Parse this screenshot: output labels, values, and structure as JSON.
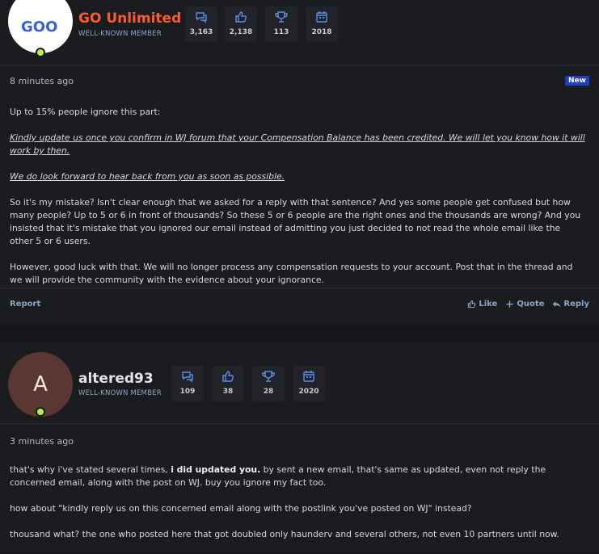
{
  "posts": [
    {
      "user": {
        "name": "GO Unlimited",
        "role": "WELL-KNOWN MEMBER",
        "avatar_text": "GOO",
        "online": true
      },
      "stats": [
        {
          "icon": "messages-icon",
          "value": "3,163"
        },
        {
          "icon": "thumbs-up-icon",
          "value": "2,138"
        },
        {
          "icon": "trophy-icon",
          "value": "113"
        },
        {
          "icon": "calendar-icon",
          "value": "2018"
        }
      ],
      "time": "8 minutes ago",
      "badge": "New",
      "paragraphs": [
        "Up to 15% people ignore this part:",
        "Kindly update us once you confirm in WJ forum that your Compensation Balance has been credited. We will let you know how it will work by then.",
        "We do look forward to hear back from you as soon as possible.",
        "So it's my mistake? Isn't clear enough that we asked for a reply with that sentence? And yes some people get confused but how many people? Up to 5 or 6 in front of thousands? So these 5 or 6 people are the right ones and the thousands are wrong? And you insisted that it's mistake that you ignored our email instead of admitting you just decided to not read the whole email like the other 5 or 6 users.",
        "However, good luck with that. We will no longer process any compensation requests to your account. Post that in the thread and we will provide the community with the evidence about your ignorance."
      ],
      "footer": {
        "report": "Report",
        "like": "Like",
        "quote": "Quote",
        "reply": "Reply"
      }
    },
    {
      "user": {
        "name": "altered93",
        "role": "WELL-KNOWN MEMBER",
        "avatar_text": "A",
        "online": true
      },
      "stats": [
        {
          "icon": "messages-icon",
          "value": "109"
        },
        {
          "icon": "thumbs-up-icon",
          "value": "38"
        },
        {
          "icon": "trophy-icon",
          "value": "28"
        },
        {
          "icon": "calendar-icon",
          "value": "2020"
        }
      ],
      "time": "3 minutes ago",
      "paragraphs": {
        "p1_before": "that's why i've stated several times, ",
        "p1_bold": "i did updated you.",
        "p1_after": " by sent a new email, that's same as updated, even not reply the concerned email, along with the post on WJ. buy you ignore my fact too.",
        "p2": "how about \"kindly reply us on this concerned email along with the postlink you've posted on WJ\" instead?",
        "p3": "thousand what? the one who posted here that got doubled only haunderv and several others, not even 10 partners until now."
      }
    }
  ],
  "colors": {
    "accent_link": "#8fa4c2",
    "username_brand": "#ff5a2a",
    "online": "#b7f04b",
    "new_badge": "#1e3fbf"
  }
}
